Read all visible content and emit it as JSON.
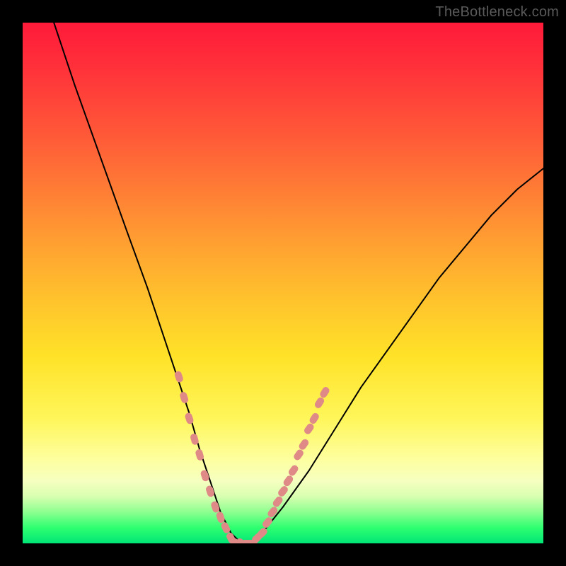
{
  "watermark": {
    "text": "TheBottleneck.com"
  },
  "colors": {
    "curve_stroke": "#000000",
    "marker_fill": "#e08a88",
    "marker_stroke": "#c97a78"
  },
  "chart_data": {
    "type": "line",
    "title": "",
    "xlabel": "",
    "ylabel": "",
    "xlim": [
      0,
      100
    ],
    "ylim": [
      0,
      100
    ],
    "grid": false,
    "series": [
      {
        "name": "bottleneck-curve",
        "x": [
          6,
          10,
          15,
          20,
          24,
          27,
          30,
          32,
          34,
          36,
          38,
          40,
          42,
          44,
          46,
          50,
          55,
          60,
          65,
          70,
          75,
          80,
          85,
          90,
          95,
          100
        ],
        "y": [
          100,
          88,
          74,
          60,
          49,
          40,
          31,
          25,
          18,
          12,
          6,
          2,
          0,
          0,
          2,
          7,
          14,
          22,
          30,
          37,
          44,
          51,
          57,
          63,
          68,
          72
        ]
      }
    ],
    "markers": [
      {
        "name": "highlighted-points",
        "points": [
          {
            "x": 30,
            "y": 32
          },
          {
            "x": 31,
            "y": 28
          },
          {
            "x": 32,
            "y": 24
          },
          {
            "x": 33,
            "y": 20
          },
          {
            "x": 34,
            "y": 17
          },
          {
            "x": 35,
            "y": 13
          },
          {
            "x": 36,
            "y": 10
          },
          {
            "x": 37,
            "y": 7
          },
          {
            "x": 38,
            "y": 5
          },
          {
            "x": 39,
            "y": 3
          },
          {
            "x": 40,
            "y": 1
          },
          {
            "x": 41,
            "y": 0
          },
          {
            "x": 42,
            "y": 0
          },
          {
            "x": 43,
            "y": 0
          },
          {
            "x": 44,
            "y": 0
          },
          {
            "x": 45,
            "y": 1
          },
          {
            "x": 46,
            "y": 2
          },
          {
            "x": 47,
            "y": 4
          },
          {
            "x": 48,
            "y": 6
          },
          {
            "x": 49,
            "y": 8
          },
          {
            "x": 50,
            "y": 10
          },
          {
            "x": 51,
            "y": 12
          },
          {
            "x": 52,
            "y": 14
          },
          {
            "x": 53,
            "y": 17
          },
          {
            "x": 54,
            "y": 19
          },
          {
            "x": 55,
            "y": 22
          },
          {
            "x": 56,
            "y": 24
          },
          {
            "x": 57,
            "y": 27
          },
          {
            "x": 58,
            "y": 29
          }
        ]
      }
    ]
  }
}
